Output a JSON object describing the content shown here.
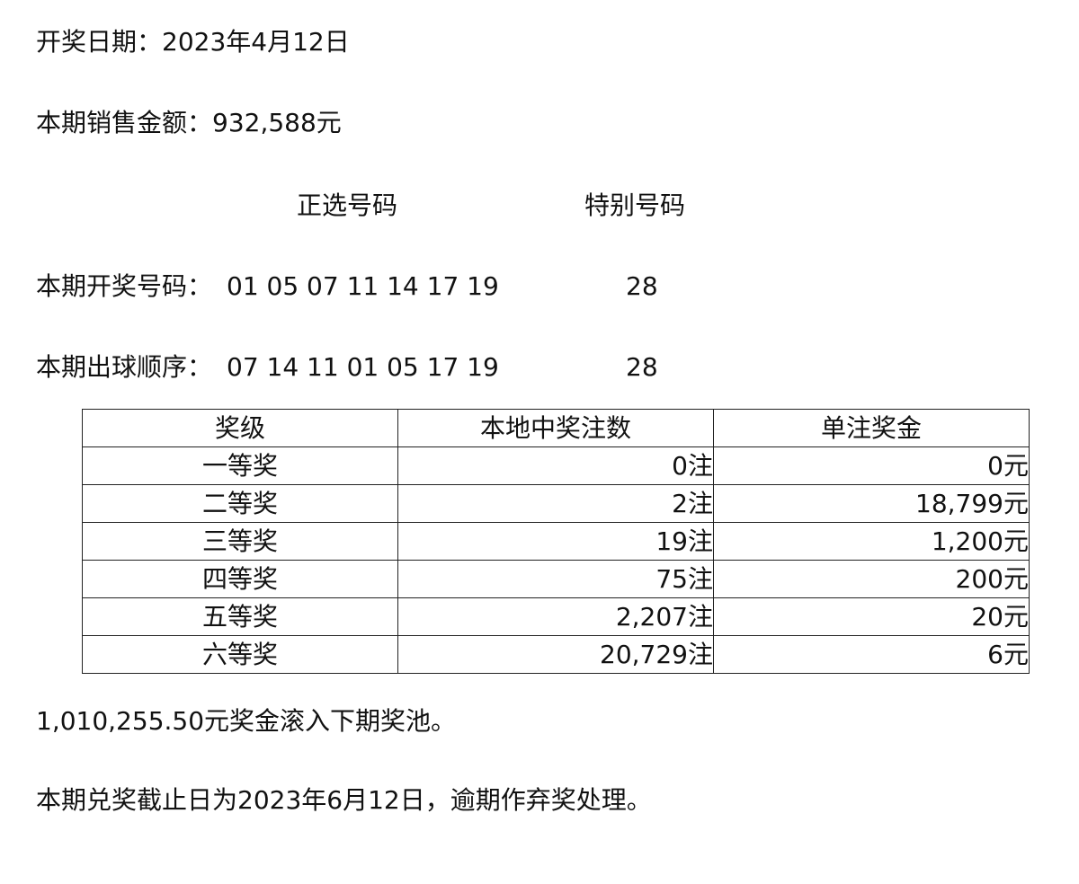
{
  "draw_date": "开奖日期：2023年4月12日",
  "sales": "本期销售金额：932,588元",
  "headers": {
    "main": "正选号码",
    "special": "特别号码"
  },
  "winning_numbers": {
    "label": "本期开奖号码：",
    "main": "01 05 07 11 14 17 19",
    "special": "28"
  },
  "draw_order": {
    "label": "本期出球顺序：",
    "main": "07 14 11 01 05 17 19",
    "special": "28"
  },
  "table": {
    "headers": [
      "奖级",
      "本地中奖注数",
      "单注奖金"
    ],
    "rows": [
      {
        "level": "一等奖",
        "count": "0注",
        "amount": "0元"
      },
      {
        "level": "二等奖",
        "count": "2注",
        "amount": "18,799元"
      },
      {
        "level": "三等奖",
        "count": "19注",
        "amount": "1,200元"
      },
      {
        "level": "四等奖",
        "count": "75注",
        "amount": "200元"
      },
      {
        "level": "五等奖",
        "count": "2,207注",
        "amount": "20元"
      },
      {
        "level": "六等奖",
        "count": "20,729注",
        "amount": "6元"
      }
    ]
  },
  "rollover": "1,010,255.50元奖金滚入下期奖池。",
  "deadline": "本期兑奖截止日为2023年6月12日，逾期作弃奖处理。"
}
